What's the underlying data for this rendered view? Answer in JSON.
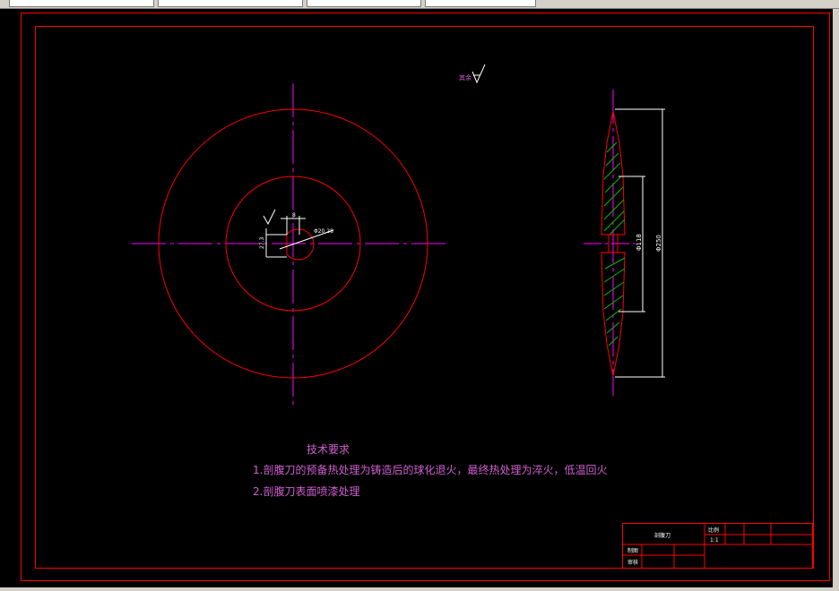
{
  "notes": {
    "title": "技术要求",
    "line1": "1.剖腹刀的预备热处理为铸造后的球化退火，最终热处理为淬火，低温回火",
    "line2": "2.剖腹刀表面喷漆处理"
  },
  "surface_symbol": {
    "label": "其余"
  },
  "dimensions": {
    "bore_width": "8",
    "bore_height": "27.3",
    "bore_diameter": "Φ20.28",
    "inner_diameter": "Φ118",
    "outer_diameter": "Φ250"
  },
  "title_block": {
    "part_name": "剖腹刀",
    "scale_label": "比例",
    "scale_value": "1:1",
    "drawn_label": "制图",
    "checked_label": "审核"
  },
  "colors": {
    "background": "#000000",
    "outline": "#ff0000",
    "centerline": "#ff00ff",
    "dimension": "#ffffff",
    "hatch": "#00c000",
    "text": "#d060d0"
  }
}
